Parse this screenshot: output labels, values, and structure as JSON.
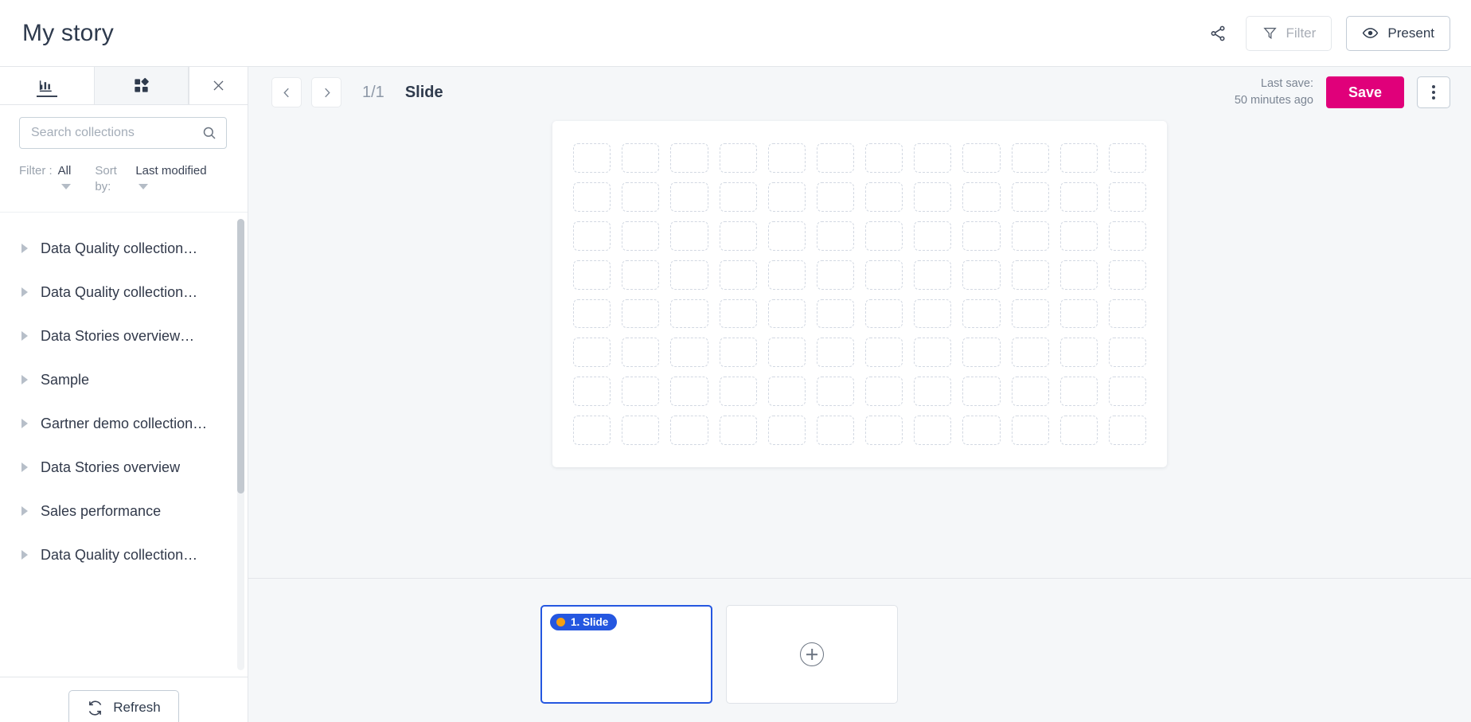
{
  "header": {
    "title": "My story",
    "share_icon": "share-icon",
    "filter_button": {
      "label": "Filter",
      "icon": "funnel-icon",
      "state": "disabled"
    },
    "present_button": {
      "label": "Present",
      "icon": "eye-icon"
    }
  },
  "sidebar": {
    "tabs": [
      {
        "name": "charts-tab",
        "icon": "bar-chart-icon",
        "active": true
      },
      {
        "name": "widgets-tab",
        "icon": "grid-apps-icon",
        "active": false
      }
    ],
    "close_icon": "close-icon",
    "search": {
      "placeholder": "Search collections",
      "value": "",
      "icon": "search-icon"
    },
    "filter": {
      "label": "Filter :",
      "value": "All"
    },
    "sort": {
      "label": "Sort by:",
      "value": "Last modified"
    },
    "collections": [
      {
        "label": "Data Quality collection…"
      },
      {
        "label": "Data Quality collection…"
      },
      {
        "label": "Data Stories overview…"
      },
      {
        "label": "Sample"
      },
      {
        "label": "Gartner demo collection…"
      },
      {
        "label": "Data Stories overview"
      },
      {
        "label": "Sales performance"
      },
      {
        "label": "Data Quality collection…"
      }
    ],
    "refresh_button": {
      "label": "Refresh",
      "icon": "sync-icon"
    }
  },
  "main": {
    "prev_icon": "chevron-left-icon",
    "next_icon": "chevron-right-icon",
    "slide_counter": "1/1",
    "slide_label": "Slide",
    "last_save_label": "Last save:",
    "last_save_time": "50 minutes ago",
    "save_button": "Save",
    "more_menu_icon": "kebab-menu-icon",
    "canvas": {
      "columns": 12,
      "rows": 8,
      "cell_style": "dashed-placeholder"
    }
  },
  "filmstrip": {
    "slides": [
      {
        "badge": "1. Slide",
        "status_dot": "orange",
        "selected": true
      }
    ],
    "add_slide": {
      "icon": "plus-circle-icon"
    }
  },
  "colors": {
    "accent_pink": "#e0007a",
    "selection_blue": "#2557e0",
    "status_orange": "#f5a013",
    "canvas_bg": "#f5f7f9",
    "text_dark": "#2f3b4d",
    "text_muted": "#9aa3ae"
  }
}
